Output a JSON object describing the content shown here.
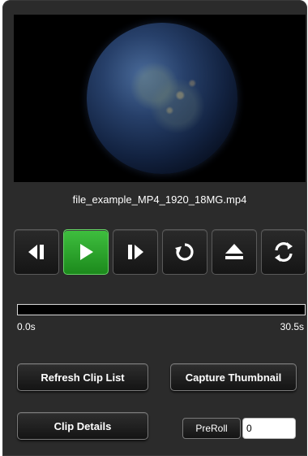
{
  "player": {
    "filename": "file_example_MP4_1920_18MG.mp4",
    "current_time": "0.0s",
    "total_time": "30.5s",
    "progress_fraction": 0.0
  },
  "controls": [
    {
      "name": "step-back-button",
      "icon": "step-back-icon",
      "active": false
    },
    {
      "name": "play-button",
      "icon": "play-icon",
      "active": true
    },
    {
      "name": "step-forward-button",
      "icon": "step-forward-icon",
      "active": false
    },
    {
      "name": "loop-button",
      "icon": "loop-icon",
      "active": false
    },
    {
      "name": "eject-button",
      "icon": "eject-icon",
      "active": false
    },
    {
      "name": "refresh-button",
      "icon": "refresh-icon",
      "active": false
    }
  ],
  "buttons": {
    "refresh_clip_list": "Refresh Clip List",
    "capture_thumbnail": "Capture Thumbnail",
    "clip_details": "Clip Details",
    "preroll": "PreRoll"
  },
  "preroll_value": "0",
  "colors": {
    "panel_bg": "#2b2b2b",
    "active_green": "#2ea82e",
    "text": "#ffffff"
  }
}
